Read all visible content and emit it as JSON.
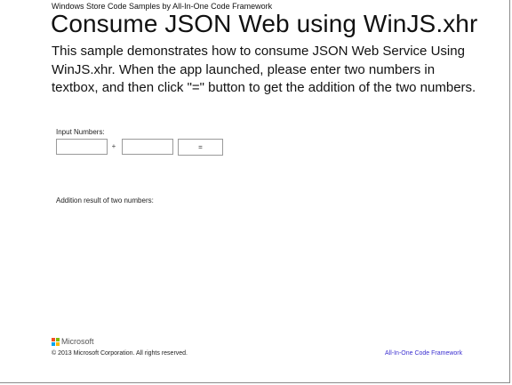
{
  "header": {
    "app_subtitle": "Windows Store Code Samples by All-In-One Code Framework",
    "title": "Consume JSON Web using WinJS.xhr",
    "description": "This sample demonstrates how to consume JSON Web Service Using WinJS.xhr. When the app launched, please enter two numbers in textbox, and then click \"=\" button to get the addition of the two numbers."
  },
  "form": {
    "input_label": "Input Numbers:",
    "first_number_value": "",
    "second_number_value": "",
    "plus_sign": "+",
    "equals_button_label": "="
  },
  "result": {
    "label": "Addition result of two numbers:"
  },
  "footer": {
    "brand": "Microsoft",
    "copyright": "© 2013 Microsoft Corporation. All rights reserved.",
    "link_text": "All-In-One Code Framework",
    "link_color": "#3b2fd0",
    "logo_colors": [
      "#f25022",
      "#7fba00",
      "#00a4ef",
      "#ffb900"
    ]
  }
}
